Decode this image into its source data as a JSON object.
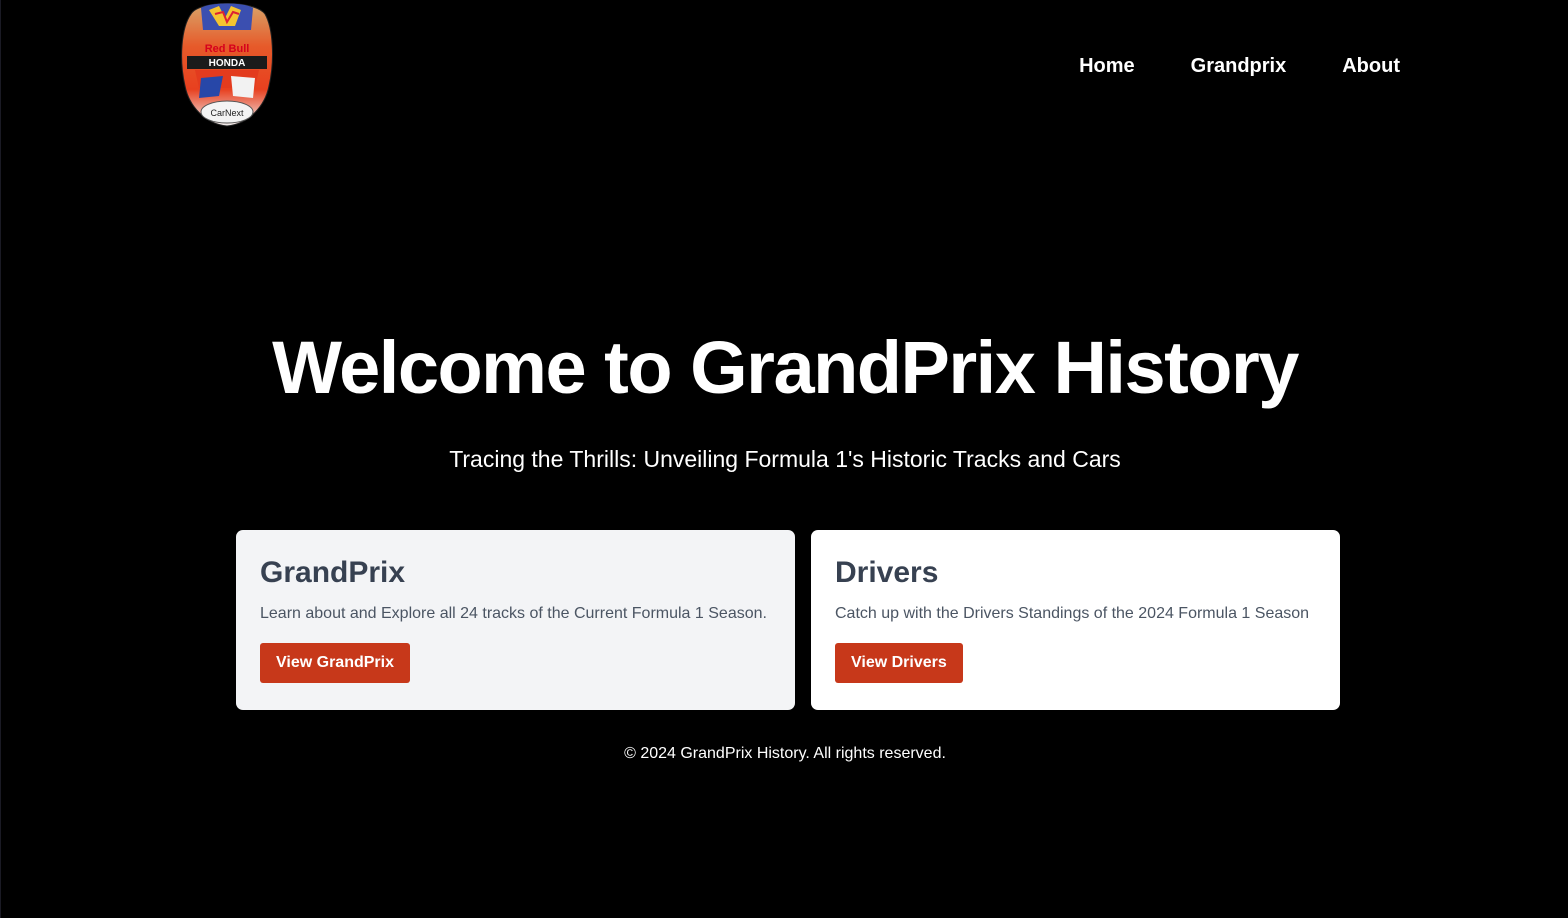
{
  "header": {
    "logo_icon": "helmet-logo-icon",
    "logo_text": [
      "Red Bull",
      "HONDA",
      "CarNext"
    ],
    "nav": [
      {
        "label": "Home"
      },
      {
        "label": "Grandprix"
      },
      {
        "label": "About"
      }
    ]
  },
  "hero": {
    "title": "Welcome to GrandPrix History",
    "subtitle": "Tracing the Thrills: Unveiling Formula 1's Historic Tracks and Cars"
  },
  "cards": [
    {
      "title": "GrandPrix",
      "description": "Learn about and Explore all 24 tracks of the Current Formula 1 Season.",
      "button_label": "View GrandPrix"
    },
    {
      "title": "Drivers",
      "description": "Catch up with the Drivers Standings of the 2024 Formula 1 Season",
      "button_label": "View Drivers"
    }
  ],
  "footer": {
    "text": "© 2024 GrandPrix History. All rights reserved."
  },
  "colors": {
    "background": "#000000",
    "accent_button": "#c7381a",
    "card_1_bg": "#f3f4f6",
    "card_2_bg": "#ffffff",
    "card_title": "#374151",
    "card_text": "#4b5563"
  }
}
